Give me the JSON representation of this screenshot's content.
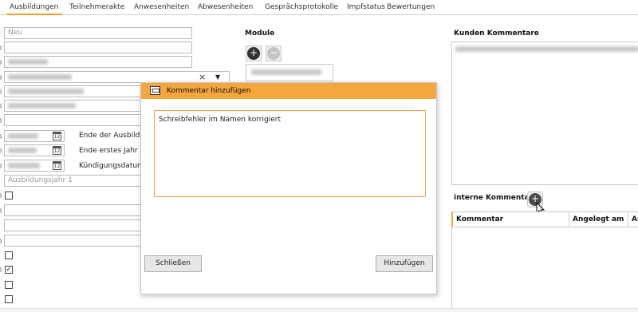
{
  "tabs": [
    {
      "label": "Ausbildungen",
      "active": true
    },
    {
      "label": "Teilnehmerakte",
      "active": false
    },
    {
      "label": "Anwesenheiten",
      "active": false
    },
    {
      "label": "Abwesenheiten",
      "active": false
    },
    {
      "label": "Gesprächsprotokolle",
      "active": false
    },
    {
      "label": "Impfstatus",
      "active": false
    },
    {
      "label": "Bewertungen",
      "active": false
    }
  ],
  "form": {
    "status_value": "Neu",
    "date_labels": {
      "end_training": "Ende der Ausbildun",
      "end_first_year": "Ende erstes Jahr",
      "termination_date": "Kündigungsdatum"
    },
    "training_year_placeholder": "Ausbildungsjahr 1",
    "dropdown_clear": "×",
    "dropdown_arrow": "▼",
    "calendar_icon_text": "12",
    "checkbox_checked_mark": "✓"
  },
  "module": {
    "title": "Module",
    "add_icon": "+",
    "remove_icon": "−"
  },
  "dialog": {
    "title": "Kommentar hinzufügen",
    "comment_text": "Schreibfehler im Namen korrigiert",
    "close_label": "Schließen",
    "add_label": "Hinzufügen"
  },
  "customer_comments": {
    "title": "Kunden Kommentare"
  },
  "internal_comments": {
    "title": "interne Kommentare",
    "add_icon": "+",
    "columns": [
      "Kommentar",
      "Angelegt am",
      "Ar"
    ]
  },
  "colors": {
    "accent": "#f5a63c",
    "tab_active_underline": "#f0a030",
    "text_border": "#f0a44a"
  }
}
